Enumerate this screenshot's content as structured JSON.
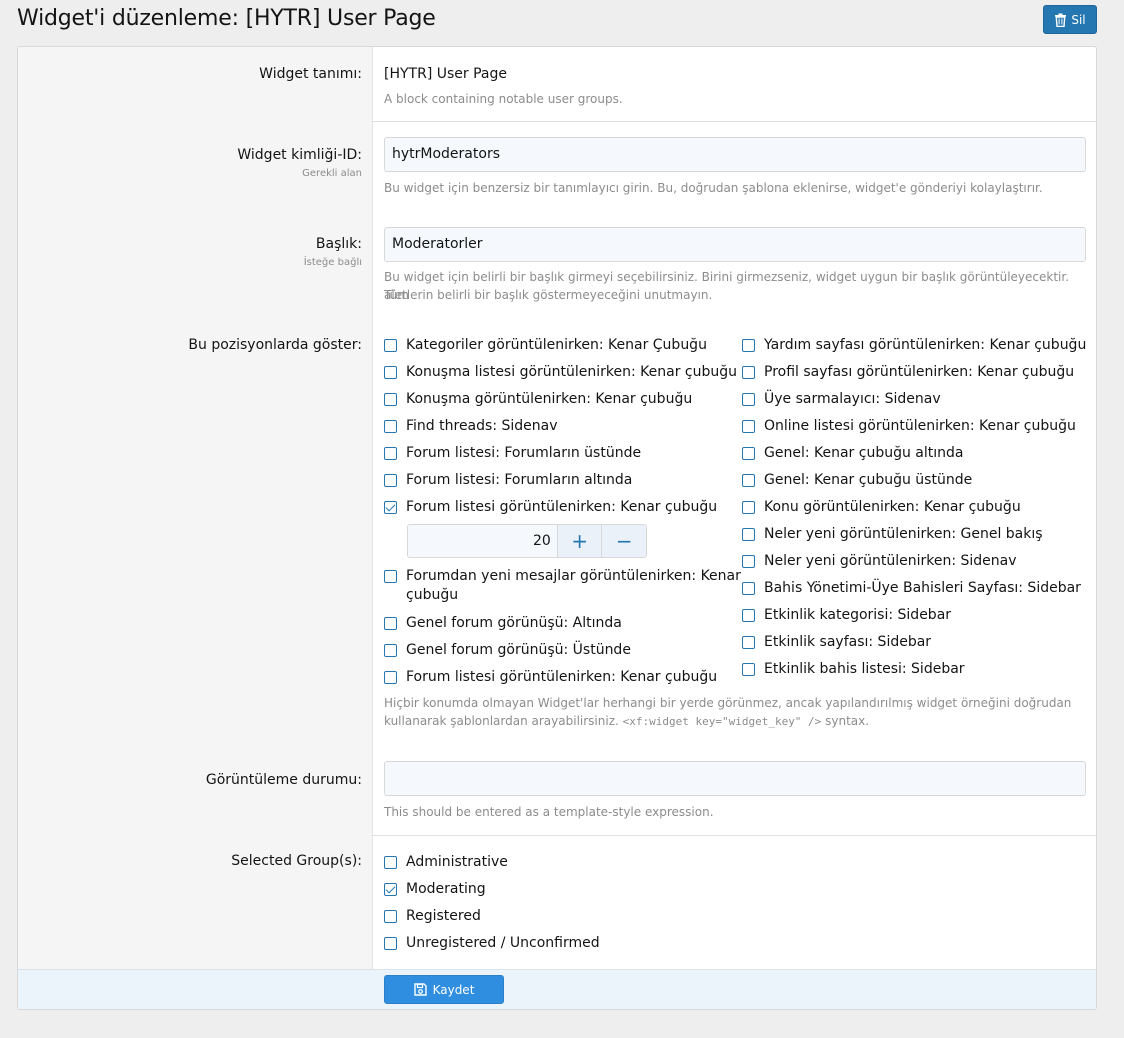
{
  "header": {
    "title": "Widget'i düzenleme: [HYTR] User Page",
    "delete_label": "Sil",
    "accent": "#2577b1"
  },
  "definition": {
    "label": "Widget tanımı:",
    "name": "[HYTR] User Page",
    "description": "A block containing notable user groups."
  },
  "widget_id": {
    "label": "Widget kimliği-ID:",
    "sublabel": "Gerekli alan",
    "value": "hytrModerators",
    "hint": "Bu widget için benzersiz bir tanımlayıcı girin. Bu, doğrudan şablona eklenirse, widget'e gönderiyi kolaylaştırır."
  },
  "title_field": {
    "label": "Başlık:",
    "sublabel": "İsteğe bağlı",
    "value": "Moderatorler",
    "hint_line1": "Bu widget için belirli bir başlık girmeyi seçebilirsiniz. Birini girmezseniz, widget uygun bir başlık görüntüleyecektir. Tüm",
    "hint_line2": "aletlerin belirli bir başlık göstermeyeceğini unutmayın."
  },
  "positions": {
    "label": "Bu pozisyonlarda göster:",
    "left": [
      {
        "label": "Kategoriler görüntülenirken: Kenar Çubuğu",
        "checked": false
      },
      {
        "label": "Konuşma listesi görüntülenirken: Kenar çubuğu",
        "checked": false
      },
      {
        "label": "Konuşma görüntülenirken: Kenar çubuğu",
        "checked": false
      },
      {
        "label": "Find threads: Sidenav",
        "checked": false
      },
      {
        "label": "Forum listesi: Forumların üstünde",
        "checked": false
      },
      {
        "label": "Forum listesi: Forumların altında",
        "checked": false
      },
      {
        "label": "Forum listesi görüntülenirken: Kenar çubuğu",
        "checked": true
      },
      {
        "label": "Forumdan yeni mesajlar görüntülenirken: Kenar",
        "label2": "çubuğu",
        "checked": false
      },
      {
        "label": "Genel forum görünüşü: Altında",
        "checked": false
      },
      {
        "label": "Genel forum görünüşü: Üstünde",
        "checked": false
      },
      {
        "label": "Forum listesi görüntülenirken: Kenar çubuğu",
        "checked": false
      }
    ],
    "right": [
      {
        "label": "Yardım sayfası görüntülenirken: Kenar çubuğu",
        "checked": false
      },
      {
        "label": "Profil sayfası görüntülenirken: Kenar çubuğu",
        "checked": false
      },
      {
        "label": "Üye sarmalayıcı: Sidenav",
        "checked": false
      },
      {
        "label": "Online listesi görüntülenirken: Kenar çubuğu",
        "checked": false
      },
      {
        "label": "Genel: Kenar çubuğu altında",
        "checked": false
      },
      {
        "label": "Genel: Kenar çubuğu üstünde",
        "checked": false
      },
      {
        "label": "Konu görüntülenirken: Kenar çubuğu",
        "checked": false
      },
      {
        "label": "Neler yeni görüntülenirken: Genel bakış",
        "checked": false
      },
      {
        "label": "Neler yeni görüntülenirken: Sidenav",
        "checked": false
      },
      {
        "label": "Bahis Yönetimi-Üye Bahisleri Sayfası: Sidebar",
        "checked": false
      },
      {
        "label": "Etkinlik kategorisi: Sidebar",
        "checked": false
      },
      {
        "label": "Etkinlik sayfası: Sidebar",
        "checked": false
      },
      {
        "label": "Etkinlik bahis listesi: Sidebar",
        "checked": false
      }
    ],
    "stepper": {
      "value": "20",
      "plus": "+",
      "minus": "−"
    },
    "hint_line1": "Hiçbir konumda olmayan Widget'lar herhangi bir yerde görünmez, ancak yapılandırılmış widget örneğini doğrudan",
    "hint_line2_a": "kullanarak şablonlardan arayabilirsiniz. ",
    "hint_code": "<xf:widget key=\"widget_key\" />",
    "hint_line2_b": " syntax."
  },
  "display_condition": {
    "label": "Görüntüleme durumu:",
    "value": "",
    "hint": "This should be entered as a template-style expression."
  },
  "groups": {
    "label": "Selected Group(s):",
    "items": [
      {
        "label": "Administrative",
        "checked": false
      },
      {
        "label": "Moderating",
        "checked": true
      },
      {
        "label": "Registered",
        "checked": false
      },
      {
        "label": "Unregistered / Unconfirmed",
        "checked": false
      }
    ]
  },
  "footer": {
    "save_label": "Kaydet"
  }
}
